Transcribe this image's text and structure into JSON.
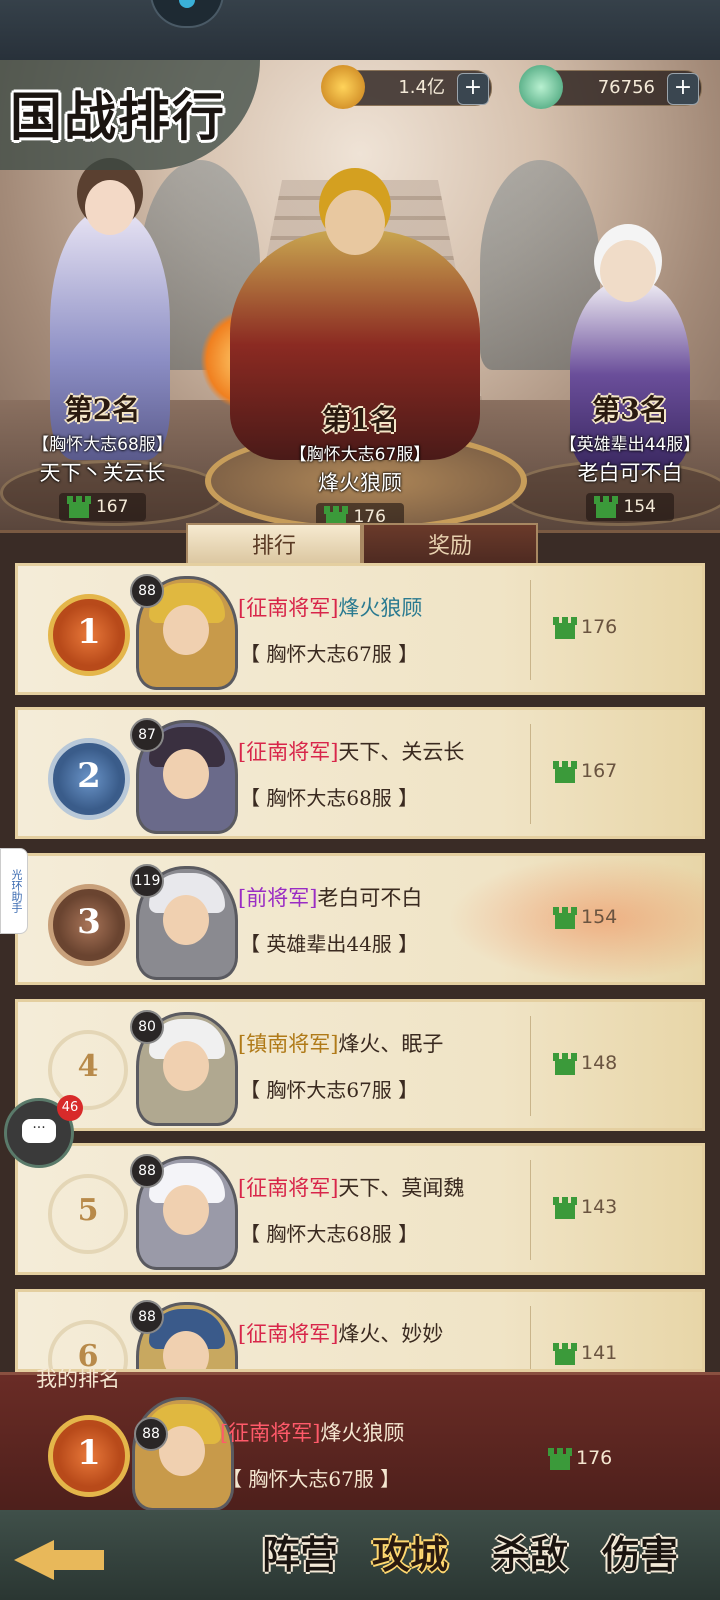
{
  "header": {
    "title": "国战排行"
  },
  "currencies": [
    {
      "icon": "coin-icon",
      "value": "1.4亿"
    },
    {
      "icon": "jade-icon",
      "value": "76756"
    }
  ],
  "podium": [
    {
      "rank": "第2名",
      "server": "【胸怀大志68服】",
      "name": "天下丶关云长",
      "score": "167"
    },
    {
      "rank": "第1名",
      "server": "【胸怀大志67服】",
      "name": "烽火狼顾",
      "score": "176"
    },
    {
      "rank": "第3名",
      "server": "【英雄辈出44服】",
      "name": "老白可不白",
      "score": "154"
    }
  ],
  "tabs": {
    "rank": "排行",
    "reward": "奖励"
  },
  "rows": [
    {
      "rank": "1",
      "level": "88",
      "title": "[征南将军]",
      "name": "烽火狼顾",
      "server": "【 胸怀大志67服 】",
      "score": "176"
    },
    {
      "rank": "2",
      "level": "87",
      "title": "[征南将军]",
      "name": "天下、关云长",
      "server": "【 胸怀大志68服 】",
      "score": "167"
    },
    {
      "rank": "3",
      "level": "119",
      "title": "[前将军]",
      "name": "老白可不白",
      "server": "【 英雄辈出44服 】",
      "score": "154"
    },
    {
      "rank": "4",
      "level": "80",
      "title": "[镇南将军]",
      "name": "烽火、眠子",
      "server": "【 胸怀大志67服 】",
      "score": "148"
    },
    {
      "rank": "5",
      "level": "88",
      "title": "[征南将军]",
      "name": "天下、莫闻魏",
      "server": "【 胸怀大志68服 】",
      "score": "143"
    },
    {
      "rank": "6",
      "level": "88",
      "title": "[征南将军]",
      "name": "烽火、妙妙",
      "server": "",
      "score": "141"
    }
  ],
  "mine": {
    "label": "我的排名",
    "rank": "1",
    "level": "88",
    "title": "[征南将军]",
    "name": "烽火狼顾",
    "server": "【 胸怀大志67服 】",
    "score": "176"
  },
  "bottom_nav": {
    "camp": "阵营",
    "siege": "攻城",
    "kill": "杀敌",
    "damage": "伤害"
  },
  "side": {
    "helper": "光环助手",
    "chat_badge": "46",
    "chat_icon": "···"
  }
}
